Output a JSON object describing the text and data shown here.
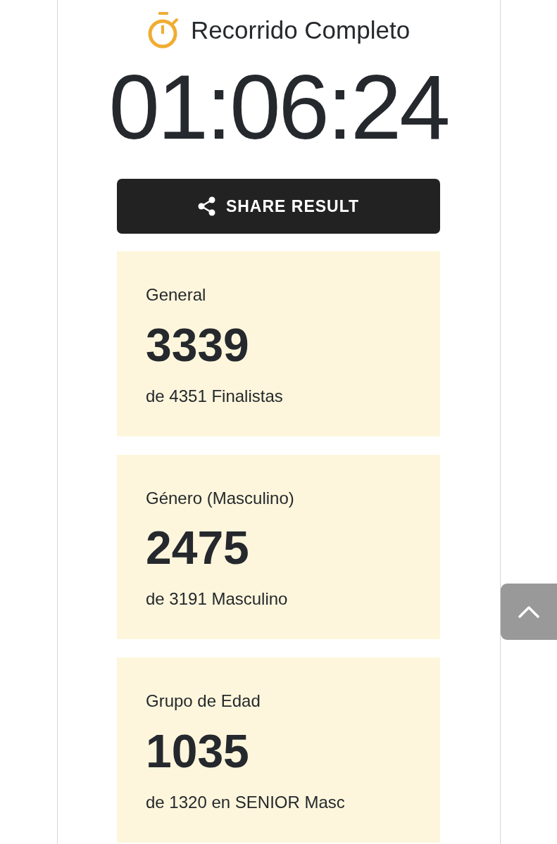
{
  "header": {
    "title": "Recorrido Completo"
  },
  "finish_time": "01:06:24",
  "share_button": {
    "label": "SHARE RESULT"
  },
  "rank_cards": [
    {
      "label": "General",
      "rank": "3339",
      "total": "de 4351 Finalistas"
    },
    {
      "label": "Género (Masculino)",
      "rank": "2475",
      "total": "de 3191 Masculino"
    },
    {
      "label": "Grupo de Edad",
      "rank": "1035",
      "total": "de 1320 en SENIOR Masc"
    }
  ]
}
